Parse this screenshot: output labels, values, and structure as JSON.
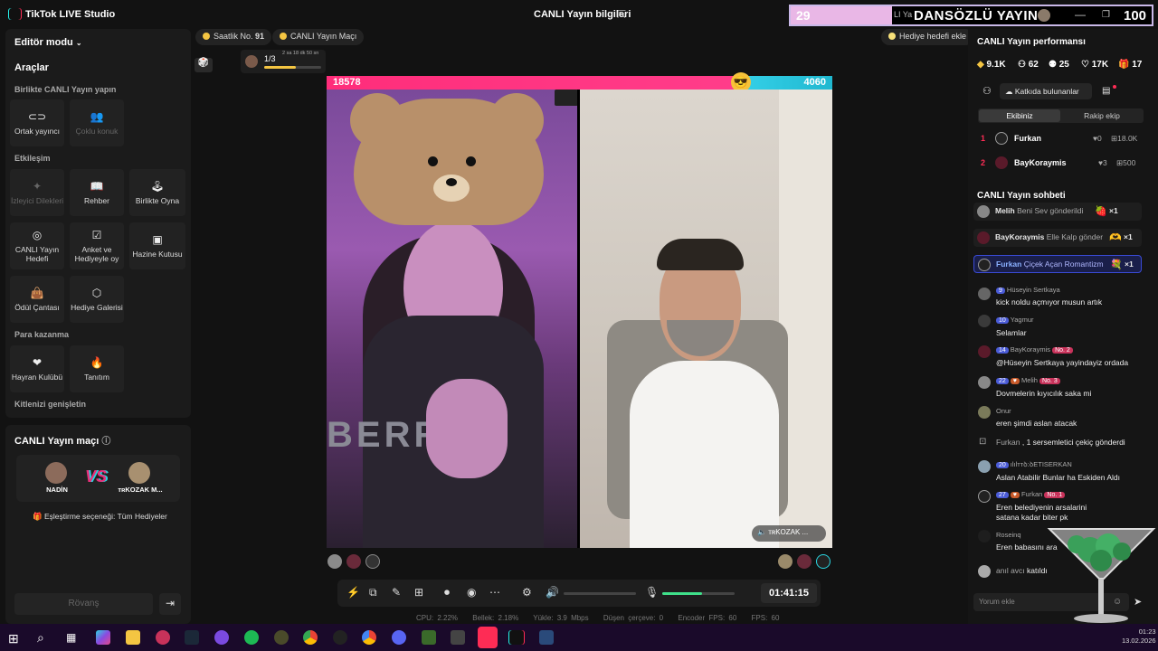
{
  "app": {
    "name": "TikTok LIVE Studio",
    "center_title": "CANLI Yayın bilgileri"
  },
  "overlay": {
    "left_num": "29",
    "small_text": "LI Ya",
    "title": "DANSÖZLÜ YAYIN",
    "right_num": "100"
  },
  "left": {
    "editor_mode": "Editör modu",
    "tools_title": "Araçlar",
    "section_together": "Birlikte CANLI Yayın yapın",
    "section_interaction": "Etkileşim",
    "section_monetize": "Para kazanma",
    "section_audience": "Kitlenizi genişletin",
    "tiles": {
      "cohost": "Ortak yayıncı",
      "multiguest": "Çoklu konuk",
      "viewer_wishes": "İzleyici Dilekleri",
      "guide": "Rehber",
      "play_together": "Birlikte Oyna",
      "live_goal": "CANLI Yayın Hedefi",
      "poll": "Anket ve Hediyeyle oy",
      "treasure": "Hazine Kutusu",
      "reward_bag": "Ödül Çantası",
      "gift_gallery": "Hediye Galerisi",
      "fan_club": "Hayran Kulübü",
      "promote": "Tanıtım"
    }
  },
  "match": {
    "title": "CANLI Yayın maçı",
    "player1": "NADİN",
    "player2": "ᴛʀKOZAK M...",
    "vs": "VS",
    "matching": "Eşleştirme seçeneği: Tüm Hediyeler",
    "rematch": "Rövanş"
  },
  "top_pills": {
    "hourly": "Saatlik No.",
    "hourly_num": "91",
    "live_match": "CANLI Yayın Maçı",
    "progress": "1/3",
    "progress_time": "2 sa 18 dk 50 sn",
    "progress_value": 0.55,
    "gift_goal": "Hediye hedefi ekle"
  },
  "battle": {
    "left_score": "18578",
    "right_score": "4060",
    "left_share": 0.82,
    "round_num": "1",
    "right_name": "ᴛʀKOZAK ..."
  },
  "controls": {
    "timer": "01:41:15",
    "mic_level": 0.55
  },
  "stats": {
    "cpu": "CPU: 2.22%",
    "mem": "Bellek: 2.18%",
    "upload": "Yükle: 3.9 Mbps",
    "dropped": "Düşen çerçeve: 0",
    "enc_fps": "Encoder FPS: 60",
    "fps": "FPS: 60"
  },
  "right": {
    "perf_title": "CANLI Yayın performansı",
    "stats": [
      "9.1K",
      "62",
      "25",
      "17K",
      "17"
    ],
    "contributors": "Katkıda bulunanlar",
    "tab_team": "Ekibiniz",
    "tab_rival": "Rakip ekip",
    "ranks": [
      {
        "n": "1",
        "name": "Furkan",
        "likes": "0",
        "coins": "18.0K"
      },
      {
        "n": "2",
        "name": "BayKoraymis",
        "likes": "3",
        "coins": "500"
      }
    ]
  },
  "chat": {
    "title": "CANLI Yayın sohbeti",
    "gifts": [
      {
        "user": "Melih",
        "text": "Beni Sev gönderildi",
        "count": "×1"
      },
      {
        "user": "BayKoraymis",
        "text": "Elle Kalp gönder",
        "count": "×1"
      },
      {
        "user": "Furkan",
        "text": "Çiçek Açan Romantizm",
        "count": "×1"
      }
    ],
    "messages": [
      {
        "badge": "9",
        "user": "Hüseyin Sertkaya",
        "text": "kick noldu açmıyor musun artık"
      },
      {
        "badge": "10",
        "user": "Yagmur",
        "text": "Selamlar"
      },
      {
        "badge": "14",
        "user": "BayKoraymis",
        "rank": "No. 2",
        "text": "@Hüseyin Sertkaya yayindayiz ordada"
      },
      {
        "badge": "22",
        "user": "Melih",
        "rank": "No. 3",
        "text": "Dovmelerin kıyıcılık saka mi"
      },
      {
        "user": "Onur",
        "text": "eren şimdi aslan atacak"
      },
      {
        "user": "Furkan",
        "text": ", 1 sersemletici çekiç gönderdi"
      },
      {
        "badge": "20",
        "user": "ılılᴛᴛꝺ:ꝺETISERKAN",
        "text": "Aslan Atabilir Bunlar ha Eskiden Aldı"
      },
      {
        "badge": "27",
        "user": "Furkan",
        "rank": "No. 1",
        "text": "Eren belediyenin arsalarini satana kadar biter pk"
      },
      {
        "user": "Roseinq",
        "text": "Eren babasını ara"
      },
      {
        "user": "anıl avcı",
        "text": "katıldı"
      }
    ],
    "placeholder": "Yorum ekle"
  },
  "taskbar": {
    "time": "01:23",
    "date": "13.02.2026"
  }
}
